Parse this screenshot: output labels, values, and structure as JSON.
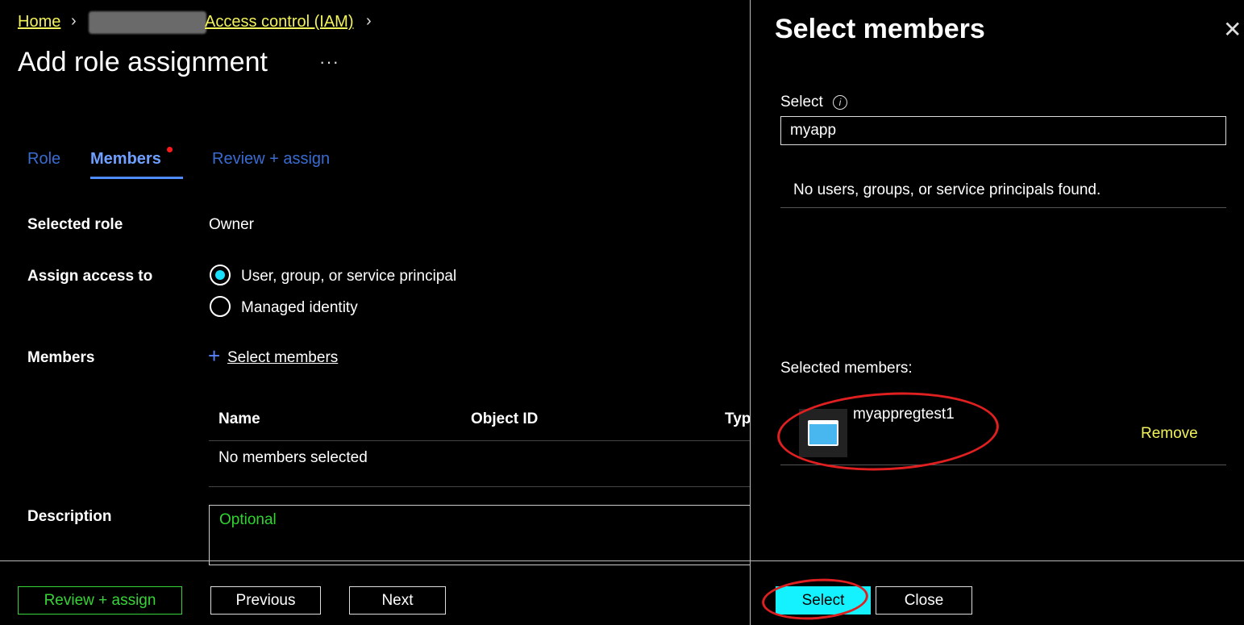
{
  "breadcrumb": {
    "home": "Home",
    "access_control": "Access control (IAM)"
  },
  "page": {
    "title": "Add role assignment",
    "more_icon": "ellipsis-icon"
  },
  "tabs": [
    {
      "label": "Role"
    },
    {
      "label": "Members"
    },
    {
      "label": "Review + assign"
    }
  ],
  "form": {
    "selected_role_label": "Selected role",
    "selected_role_value": "Owner",
    "assign_access_label": "Assign access to",
    "assign_options": [
      {
        "label": "User, group, or service principal",
        "checked": true
      },
      {
        "label": "Managed identity",
        "checked": false
      }
    ],
    "members_label": "Members",
    "select_members_link": "Select members",
    "table": {
      "columns": [
        "Name",
        "Object ID",
        "Typ"
      ],
      "empty": "No members selected"
    },
    "description_label": "Description",
    "description_placeholder": "Optional"
  },
  "footer": {
    "review_assign": "Review + assign",
    "previous": "Previous",
    "next": "Next"
  },
  "panel": {
    "title": "Select members",
    "select_label": "Select",
    "search_value": "myapp",
    "no_results": "No users, groups, or service principals found.",
    "selected_members_label": "Selected members:",
    "selected_members": [
      {
        "name": "myappregtest1",
        "remove": "Remove",
        "icon": "app-registration-icon"
      }
    ],
    "select_button": "Select",
    "close_button": "Close"
  },
  "colors": {
    "link": "#f2f25a",
    "tab_active": "#6fa0ff",
    "radio_fill": "#19e0ff",
    "primary_button": "#14f2ff",
    "annotation": "#e02020"
  }
}
